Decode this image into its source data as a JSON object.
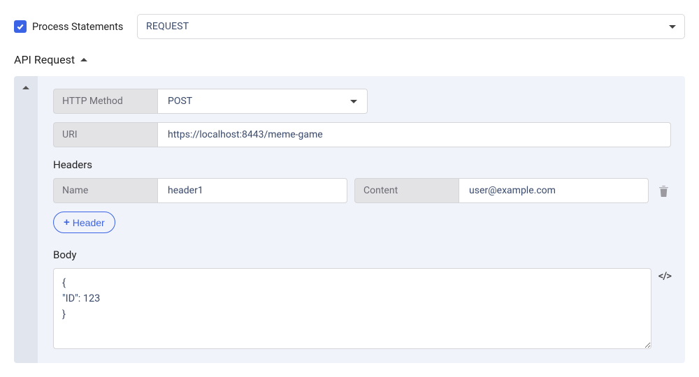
{
  "top": {
    "checkbox_checked": true,
    "checkbox_label": "Process Statements",
    "select_value": "REQUEST"
  },
  "section": {
    "title": "API Request"
  },
  "request": {
    "http_method_label": "HTTP Method",
    "http_method_value": "POST",
    "uri_label": "URI",
    "uri_value": "https://localhost:8443/meme-game",
    "headers_heading": "Headers",
    "headers": [
      {
        "name_label": "Name",
        "name_value": "header1",
        "content_label": "Content",
        "content_value": "user@example.com"
      }
    ],
    "add_header_label": "Header",
    "body_heading": "Body",
    "body_value": "{\n\"ID\": 123\n}",
    "code_toggle_label": "</>"
  }
}
